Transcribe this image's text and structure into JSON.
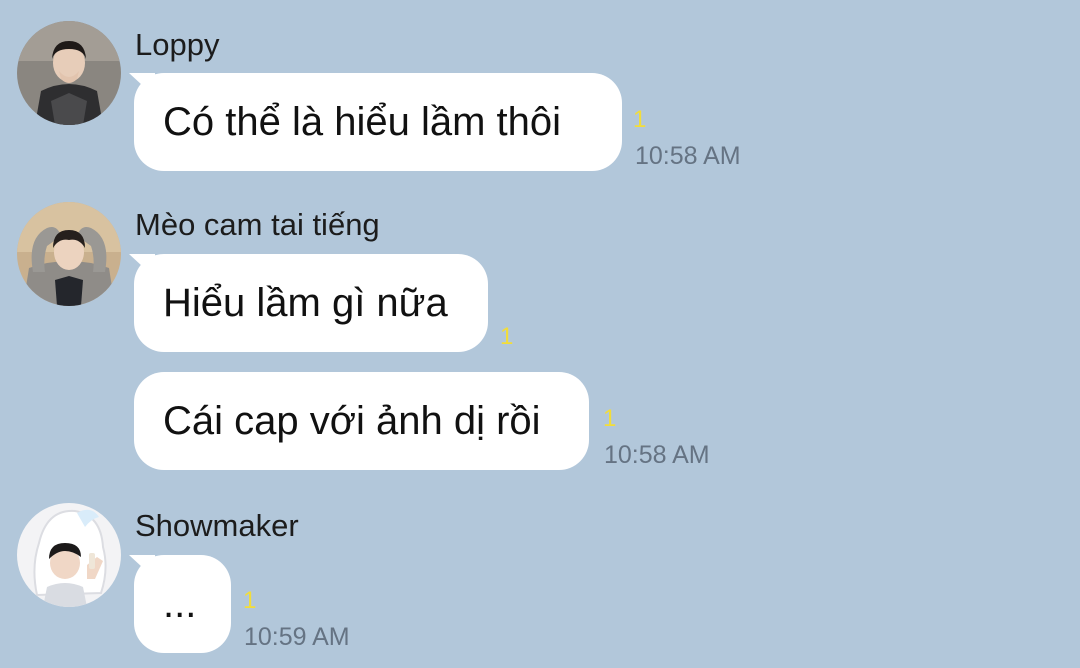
{
  "messages": [
    {
      "sender": "Loppy",
      "text": "Có thể là hiểu lầm thôi",
      "unread": "1",
      "time": "10:58 AM"
    },
    {
      "sender": "Mèo cam tai tiếng",
      "text": "Hiểu lầm gì nữa",
      "unread": "1"
    },
    {
      "text": "Cái cap với ảnh dị rồi",
      "unread": "1",
      "time": "10:58 AM"
    },
    {
      "sender": "Showmaker",
      "text": "...",
      "unread": "1",
      "time": "10:59 AM"
    }
  ],
  "colors": {
    "background": "#b2c7da",
    "bubble": "#ffffff",
    "unread": "#f2dd3a",
    "time": "#657383"
  }
}
